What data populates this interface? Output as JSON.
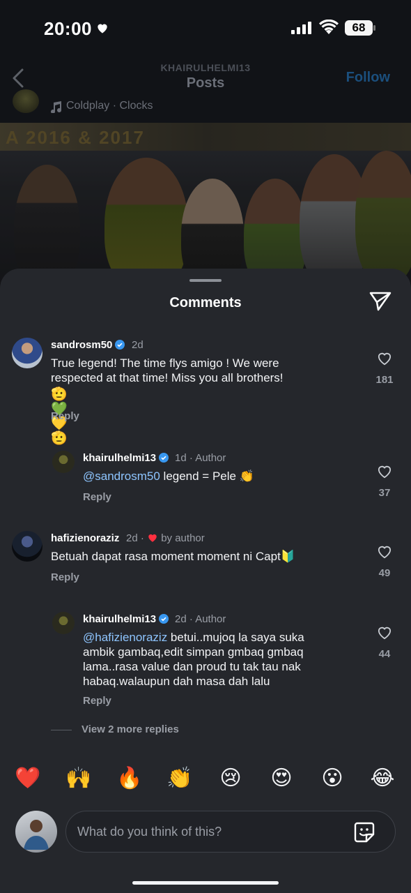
{
  "status_bar": {
    "time": "20:00",
    "battery": "68"
  },
  "header": {
    "username": "KHAIRULHELMI13",
    "title": "Posts",
    "follow_label": "Follow"
  },
  "post": {
    "music": "Coldplay · Clocks",
    "banner_text": "A 2016 & 2017"
  },
  "sheet": {
    "title": "Comments"
  },
  "comments": [
    {
      "user": "sandrosm50",
      "time": "2d",
      "text": "True legend! The time flys amigo ! We were respected at that time! Miss you all brothers!",
      "emojis": "🫡💚💛🫡",
      "reply": "Reply",
      "likes": "181",
      "replies": [
        {
          "user": "khairulhelmi13",
          "time": "1d",
          "tag": "Author",
          "mention": "@sandrosm50",
          "text": " legend = Pele 👏",
          "reply": "Reply",
          "likes": "37"
        }
      ]
    },
    {
      "user": "hafizienoraziz",
      "time": "2d",
      "badge": "by author",
      "text": "Betuah dapat rasa moment moment ni Capt🔰",
      "reply": "Reply",
      "likes": "49",
      "replies": [
        {
          "user": "khairulhelmi13",
          "time": "2d",
          "tag": "Author",
          "mention": "@hafizienoraziz",
          "text": " betui..mujoq la saya suka ambik gambaq,edit simpan gmbaq gmbaq lama..rasa value dan proud tu tak tau nak habaq.walaupun dah masa dah lalu",
          "reply": "Reply",
          "likes": "44"
        }
      ],
      "view_more": "View 2 more replies"
    }
  ],
  "reactions": [
    "❤️",
    "🙌",
    "🔥",
    "👏",
    "😢",
    "😍",
    "😮",
    "😂"
  ],
  "composer": {
    "placeholder": "What do you think of this?"
  },
  "colors": {
    "background": "#25272c",
    "mention": "#8ec5ff",
    "verified": "#3897f0",
    "heart": "#ff3040"
  },
  "icons": [
    "back-chevron-icon",
    "music-note-icon",
    "share-icon",
    "verified-icon",
    "heart-outline-icon",
    "sticker-icon"
  ]
}
